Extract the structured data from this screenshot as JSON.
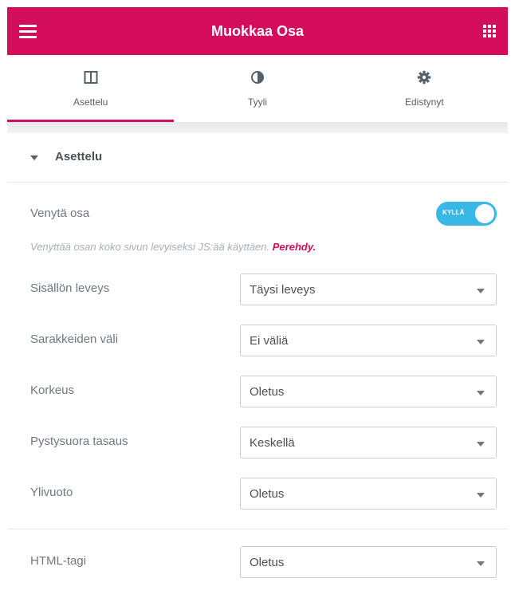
{
  "header": {
    "title": "Muokkaa Osa",
    "menu_icon": "hamburger-menu-icon",
    "apps_icon": "grid-apps-icon",
    "brand_color": "#d30c5c"
  },
  "tabs": [
    {
      "label": "Asettelu",
      "icon": "layout-columns-icon",
      "active": true
    },
    {
      "label": "Tyyli",
      "icon": "contrast-half-circle-icon",
      "active": false
    },
    {
      "label": "Edistynyt",
      "icon": "gear-icon",
      "active": false
    }
  ],
  "section": {
    "title": "Asettelu",
    "expanded": true
  },
  "stretch": {
    "label": "Venytä osa",
    "toggle_text": "KYLLÄ",
    "toggle_on": true,
    "toggle_color": "#39b7e6",
    "description": "Venyttää osan koko sivun levyiseksi JS:ää käyttäen.",
    "link": "Perehdy."
  },
  "fields": {
    "content_width": {
      "label": "Sisällön leveys",
      "value": "Täysi leveys"
    },
    "column_gap": {
      "label": "Sarakkeiden väli",
      "value": "Ei väliä"
    },
    "height": {
      "label": "Korkeus",
      "value": "Oletus"
    },
    "vertical_align": {
      "label": "Pystysuora tasaus",
      "value": "Keskellä"
    },
    "overflow": {
      "label": "Ylivuoto",
      "value": "Oletus"
    },
    "html_tag": {
      "label": "HTML-tagi",
      "value": "Oletus"
    }
  }
}
